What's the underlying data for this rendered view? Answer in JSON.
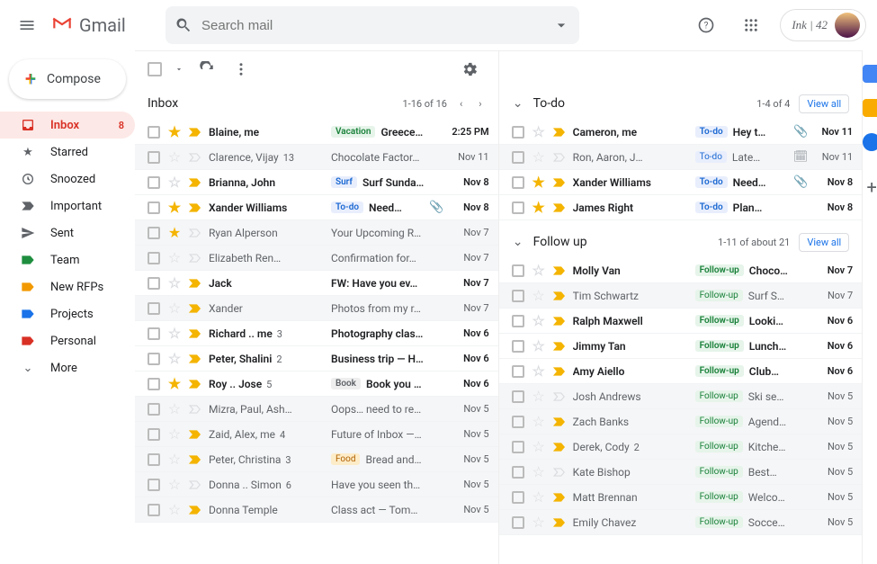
{
  "app": {
    "name": "Gmail",
    "search_placeholder": "Search mail",
    "account_label": "Ink | 42"
  },
  "compose_label": "Compose",
  "nav": [
    {
      "id": "inbox",
      "label": "Inbox",
      "badge": "8",
      "icon": "inbox",
      "active": true
    },
    {
      "id": "starred",
      "label": "Starred",
      "icon": "star"
    },
    {
      "id": "snoozed",
      "label": "Snoozed",
      "icon": "clock"
    },
    {
      "id": "important",
      "label": "Important",
      "icon": "important"
    },
    {
      "id": "sent",
      "label": "Sent",
      "icon": "sent"
    },
    {
      "id": "team",
      "label": "Team",
      "icon": "label",
      "color": "#1e8e3e"
    },
    {
      "id": "newrfps",
      "label": "New RFPs",
      "icon": "label",
      "color": "#f29900"
    },
    {
      "id": "projects",
      "label": "Projects",
      "icon": "label",
      "color": "#1a73e8"
    },
    {
      "id": "personal",
      "label": "Personal",
      "icon": "label",
      "color": "#d93025"
    },
    {
      "id": "more",
      "label": "More",
      "icon": "chevron-down"
    }
  ],
  "inbox": {
    "title": "Inbox",
    "range": "1-16 of 16",
    "rows": [
      {
        "unread": true,
        "star": true,
        "imp": "on",
        "sender": "Blaine, me",
        "tag": {
          "text": "Vacation",
          "bg": "#e6f4ea",
          "fg": "#188038"
        },
        "subject": "Greece…",
        "date": "2:25 PM"
      },
      {
        "unread": false,
        "star": false,
        "imp": "off",
        "sender": "Clarence, Vijay",
        "count": "13",
        "subject": "Chocolate Factor…",
        "date": "Nov 11"
      },
      {
        "unread": true,
        "star": false,
        "imp": "on",
        "sender": "Brianna, John",
        "tag": {
          "text": "Surf",
          "bg": "#e8eefc",
          "fg": "#1967d2"
        },
        "subject": "Surf Sunda…",
        "date": "Nov 8"
      },
      {
        "unread": true,
        "star": true,
        "imp": "on",
        "sender": "Xander Williams",
        "tag": {
          "text": "To-do",
          "bg": "#e8eefc",
          "fg": "#1967d2"
        },
        "subject": "Need…",
        "extra": "attach",
        "date": "Nov 8"
      },
      {
        "unread": false,
        "star": true,
        "imp": "off",
        "sender": "Ryan Alperson",
        "subject": "Your Upcoming R…",
        "date": "Nov 7"
      },
      {
        "unread": false,
        "star": false,
        "imp": "off",
        "sender": "Elizabeth Ren…",
        "subject": "Confirmation for…",
        "date": "Nov 7"
      },
      {
        "unread": true,
        "star": false,
        "imp": "on",
        "sender": "Jack",
        "subject": "FW: Have you ev…",
        "date": "Nov 7"
      },
      {
        "unread": false,
        "star": false,
        "imp": "on",
        "sender": "Xander",
        "subject": "Photos from my r…",
        "date": "Nov 7"
      },
      {
        "unread": true,
        "star": false,
        "imp": "on",
        "sender": "Richard .. me",
        "count": "3",
        "subject": "Photography clas…",
        "date": "Nov 6"
      },
      {
        "unread": true,
        "star": false,
        "imp": "on",
        "sender": "Peter, Shalini",
        "count": "2",
        "subject": "Business trip — H…",
        "date": "Nov 6"
      },
      {
        "unread": true,
        "star": true,
        "imp": "on",
        "sender": "Roy .. Jose",
        "count": "5",
        "tag": {
          "text": "Book",
          "bg": "#eeeeee",
          "fg": "#5f6368"
        },
        "subject": "Book you r…",
        "date": "Nov 6"
      },
      {
        "unread": false,
        "star": false,
        "imp": "off",
        "sender": "Mizra, Paul, Ash…",
        "subject": "Oops… need to re…",
        "date": "Nov 5"
      },
      {
        "unread": false,
        "star": false,
        "imp": "on",
        "sender": "Zaid, Alex, me",
        "count": "4",
        "subject": "Future of Inbox —…",
        "date": "Nov 5"
      },
      {
        "unread": false,
        "star": false,
        "imp": "on",
        "sender": "Peter, Christina",
        "count": "3",
        "tag": {
          "text": "Food",
          "bg": "#fdecc8",
          "fg": "#b06000"
        },
        "subject": "Bread and…",
        "date": "Nov 5"
      },
      {
        "unread": false,
        "star": false,
        "imp": "off",
        "sender": "Donna .. Simon",
        "count": "6",
        "subject": "Have you seen th…",
        "date": "Nov 5"
      },
      {
        "unread": false,
        "star": false,
        "imp": "on",
        "sender": "Donna Temple",
        "subject": "Class act — Tom…",
        "date": "Nov 5"
      }
    ]
  },
  "todo": {
    "title": "To-do",
    "range": "1-4 of 4",
    "viewall": "View all",
    "rows": [
      {
        "unread": true,
        "star": false,
        "imp": "on",
        "sender": "Cameron, me",
        "tag": {
          "text": "To-do",
          "bg": "#e8eefc",
          "fg": "#1967d2"
        },
        "subject": "Hey t…",
        "extra": "attach",
        "date": "Nov 11"
      },
      {
        "unread": false,
        "star": false,
        "imp": "off",
        "sender": "Ron, Aaron, J…",
        "tag": {
          "text": "To-do",
          "bg": "#e8eefc",
          "fg": "#1967d2"
        },
        "subject": "Late…",
        "extra": "calendar",
        "date": "Nov 11"
      },
      {
        "unread": true,
        "star": true,
        "imp": "on",
        "sender": "Xander Williams",
        "tag": {
          "text": "To-do",
          "bg": "#e8eefc",
          "fg": "#1967d2"
        },
        "subject": "Need…",
        "extra": "attach",
        "date": "Nov 8"
      },
      {
        "unread": true,
        "star": true,
        "imp": "on",
        "sender": "James Right",
        "tag": {
          "text": "To-do",
          "bg": "#e8eefc",
          "fg": "#1967d2"
        },
        "subject": "Plan…",
        "date": "Nov 8"
      }
    ]
  },
  "followup": {
    "title": "Follow up",
    "range": "1-11 of about 21",
    "viewall": "View all",
    "rows": [
      {
        "unread": true,
        "star": false,
        "imp": "on",
        "sender": "Molly Van",
        "tag": {
          "text": "Follow-up",
          "bg": "#e6f4ea",
          "fg": "#188038"
        },
        "subject": "Choco…",
        "date": "Nov 7"
      },
      {
        "unread": false,
        "star": false,
        "imp": "on",
        "sender": "Tim Schwartz",
        "tag": {
          "text": "Follow-up",
          "bg": "#e6f4ea",
          "fg": "#188038"
        },
        "subject": "Surf S…",
        "date": "Nov 7"
      },
      {
        "unread": true,
        "star": false,
        "imp": "on",
        "sender": "Ralph Maxwell",
        "tag": {
          "text": "Follow-up",
          "bg": "#e6f4ea",
          "fg": "#188038"
        },
        "subject": "Looki…",
        "date": "Nov 6"
      },
      {
        "unread": true,
        "star": false,
        "imp": "on",
        "sender": "Jimmy Tan",
        "tag": {
          "text": "Follow-up",
          "bg": "#e6f4ea",
          "fg": "#188038"
        },
        "subject": "Lunch…",
        "date": "Nov 6"
      },
      {
        "unread": true,
        "star": false,
        "imp": "on",
        "sender": "Amy Aiello",
        "tag": {
          "text": "Follow-up",
          "bg": "#e6f4ea",
          "fg": "#188038"
        },
        "subject": "Club…",
        "date": "Nov 6"
      },
      {
        "unread": false,
        "star": false,
        "imp": "off",
        "sender": "Josh Andrews",
        "tag": {
          "text": "Follow-up",
          "bg": "#e6f4ea",
          "fg": "#188038"
        },
        "subject": "Ski se…",
        "date": "Nov 5"
      },
      {
        "unread": false,
        "star": false,
        "imp": "on",
        "sender": "Zach Banks",
        "tag": {
          "text": "Follow-up",
          "bg": "#e6f4ea",
          "fg": "#188038"
        },
        "subject": "Agend…",
        "date": "Nov 5"
      },
      {
        "unread": false,
        "star": false,
        "imp": "on",
        "sender": "Derek, Cody",
        "count": "2",
        "tag": {
          "text": "Follow-up",
          "bg": "#e6f4ea",
          "fg": "#188038"
        },
        "subject": "Kitche…",
        "date": "Nov 5"
      },
      {
        "unread": false,
        "star": false,
        "imp": "off",
        "sender": "Kate Bishop",
        "tag": {
          "text": "Follow-up",
          "bg": "#e6f4ea",
          "fg": "#188038"
        },
        "subject": "Best…",
        "date": "Nov 5"
      },
      {
        "unread": false,
        "star": false,
        "imp": "on",
        "sender": "Matt Brennan",
        "tag": {
          "text": "Follow-up",
          "bg": "#e6f4ea",
          "fg": "#188038"
        },
        "subject": "Welco…",
        "date": "Nov 5"
      },
      {
        "unread": false,
        "star": false,
        "imp": "on",
        "sender": "Emily Chavez",
        "tag": {
          "text": "Follow-up",
          "bg": "#e6f4ea",
          "fg": "#188038"
        },
        "subject": "Socce…",
        "date": "Nov 5"
      }
    ]
  }
}
